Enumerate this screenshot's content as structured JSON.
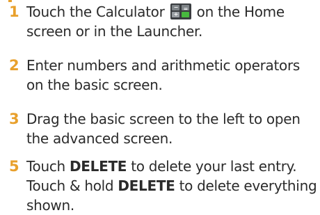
{
  "steps": [
    {
      "number": "1",
      "text_before_icon": "Touch the Calculator",
      "icon": "calculator-app-icon",
      "text_after_icon": "on the Home screen or in the Launcher."
    },
    {
      "number": "2",
      "text": "Enter numbers and arithmetic operators on the basic screen."
    },
    {
      "number": "3",
      "text": "Drag the basic screen to the left to open the advanced screen."
    },
    {
      "number": "5",
      "segments": [
        "Touch ",
        "DELETE",
        " to delete your last entry. Touch & hold ",
        "DELETE",
        " to delete everything shown."
      ]
    }
  ],
  "colors": {
    "accent": "#e8a02c",
    "text": "#2b2b2b"
  }
}
